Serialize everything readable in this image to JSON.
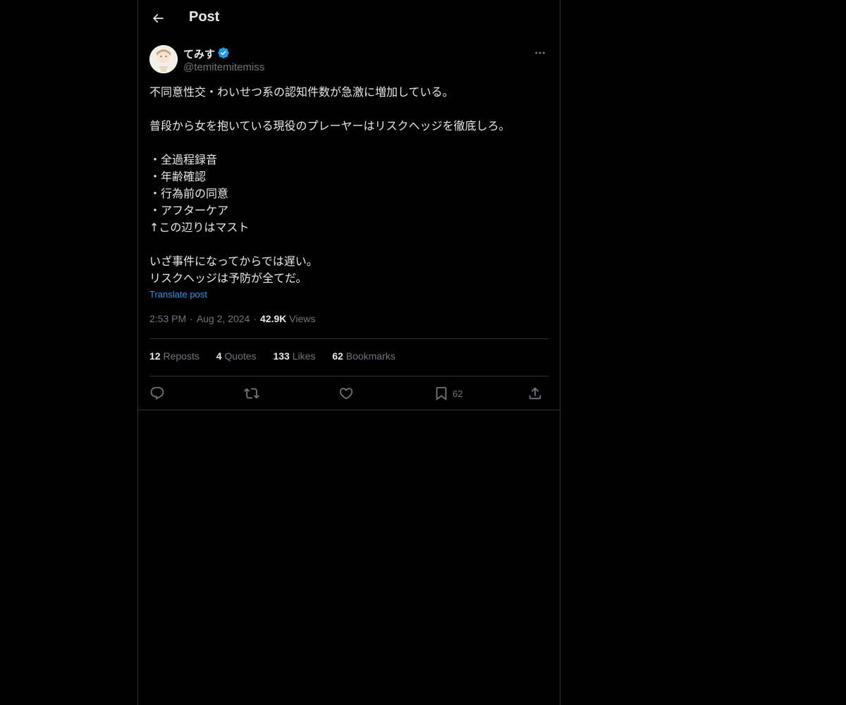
{
  "colors": {
    "background": "#000000",
    "text_primary": "#e7e9ea",
    "text_secondary": "#71767b",
    "accent": "#1d9bf0",
    "border": "#2f3336"
  },
  "header": {
    "title": "Post",
    "back_icon": "arrow-left-icon"
  },
  "post": {
    "author": {
      "display_name": "てみす",
      "handle": "@temitemitemiss",
      "verified_icon": "verified-badge-icon"
    },
    "more_icon": "more-dots-icon",
    "lines": [
      "不同意性交・わいせつ系の認知件数が急激に増加している。",
      "",
      "普段から女を抱いている現役のプレーヤーはリスクヘッジを徹底しろ。",
      "",
      "・全過程録音",
      "・年齢確認",
      "・行為前の同意",
      "・アフターケア",
      "↑この辺りはマスト",
      "",
      "いざ事件になってからでは遅い。",
      "リスクヘッジは予防が全てだ。"
    ],
    "translate_label": "Translate post",
    "time": "2:53 PM",
    "date": "Aug 2, 2024",
    "views_count": "42.9K",
    "views_label": "Views"
  },
  "stats": {
    "reposts": {
      "count": "12",
      "label": "Reposts"
    },
    "quotes": {
      "count": "4",
      "label": "Quotes"
    },
    "likes": {
      "count": "133",
      "label": "Likes"
    },
    "bookmarks": {
      "count": "62",
      "label": "Bookmarks"
    }
  },
  "actions": {
    "reply_icon": "reply-icon",
    "repost_icon": "repost-icon",
    "like_icon": "heart-icon",
    "bookmark_icon": "bookmark-icon",
    "bookmark_count": "62",
    "share_icon": "share-icon"
  }
}
